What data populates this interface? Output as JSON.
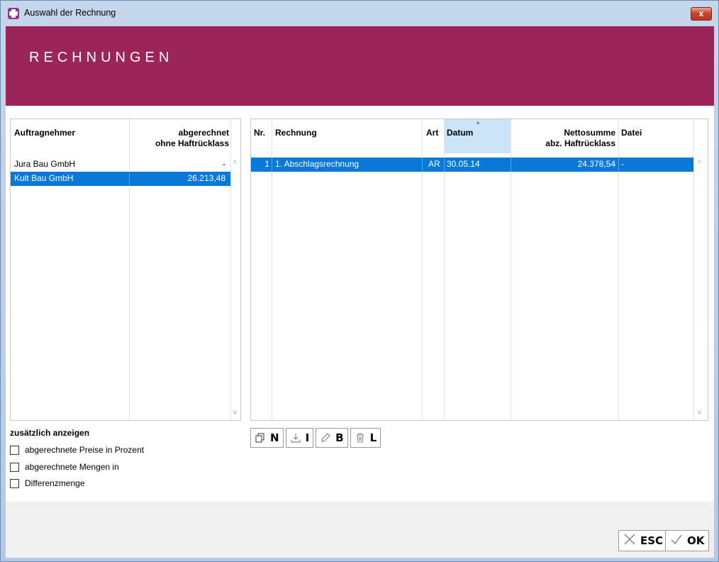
{
  "window": {
    "title": "Auswahl der Rechnung",
    "close_label": "x"
  },
  "header": {
    "title": "RECHNUNGEN"
  },
  "left_grid": {
    "headers": {
      "col1": "Auftragnehmer",
      "col2_line1": "abgerechnet",
      "col2_line2": "ohne Haftrücklass"
    },
    "rows": [
      {
        "name": "Jura Bau GmbH",
        "value": "-"
      },
      {
        "name": "Kult Bau GmbH",
        "value": "26.213,48"
      }
    ]
  },
  "right_grid": {
    "headers": {
      "nr": "Nr.",
      "rechnung": "Rechnung",
      "art": "Art",
      "datum": "Datum",
      "netto_line1": "Nettosumme",
      "netto_line2": "abz. Haftrücklass",
      "datei": "Datei"
    },
    "rows": [
      {
        "nr": "1",
        "rechnung": "1. Abschlagsrechnung",
        "art": "AR",
        "datum": "30.05.14",
        "netto": "24.378,54",
        "datei": "-"
      }
    ]
  },
  "toolbar": {
    "new_label": "N",
    "import_label": "I",
    "edit_label": "B",
    "delete_label": "L"
  },
  "options": {
    "title": "zusätzlich anzeigen",
    "items": [
      {
        "label": "abgerechnete Preise in Prozent",
        "checked": false
      },
      {
        "label": "abgerechnete Mengen in",
        "checked": false
      },
      {
        "label": "Differenzmenge",
        "checked": false
      }
    ]
  },
  "footer": {
    "esc_label": "ESC",
    "ok_label": "OK"
  },
  "colors": {
    "accent": "#9b2458",
    "selection": "#0a78d7",
    "sorted_header": "#cce4f7"
  }
}
